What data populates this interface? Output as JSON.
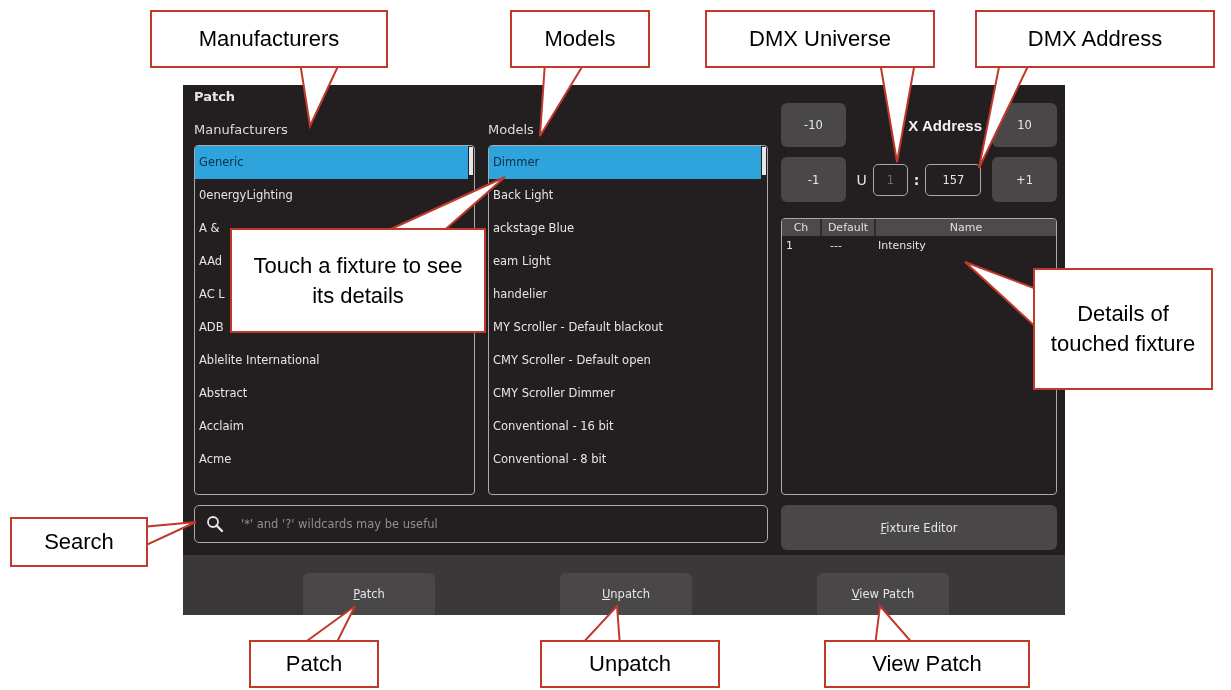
{
  "window": {
    "title": "Patch"
  },
  "manufacturers": {
    "label": "Manufacturers",
    "items": [
      {
        "name": "Generic",
        "selected": true
      },
      {
        "name": "0energyLighting",
        "selected": false
      },
      {
        "name": "A &",
        "selected": false
      },
      {
        "name": "AAd",
        "selected": false
      },
      {
        "name": "AC L",
        "selected": false
      },
      {
        "name": "ADB",
        "selected": false
      },
      {
        "name": "Ablelite International",
        "selected": false
      },
      {
        "name": "Abstract",
        "selected": false
      },
      {
        "name": "Acclaim",
        "selected": false
      },
      {
        "name": "Acme",
        "selected": false
      }
    ]
  },
  "models": {
    "label": "Models",
    "items": [
      {
        "name": "Dimmer",
        "selected": true
      },
      {
        "name": "Back Light",
        "selected": false
      },
      {
        "name": "ackstage Blue",
        "selected": false
      },
      {
        "name": "eam Light",
        "selected": false
      },
      {
        "name": "handelier",
        "selected": false
      },
      {
        "name": "MY Scroller - Default blackout",
        "selected": false
      },
      {
        "name": "CMY Scroller - Default open",
        "selected": false
      },
      {
        "name": "CMY Scroller Dimmer",
        "selected": false
      },
      {
        "name": "Conventional - 16 bit",
        "selected": false
      },
      {
        "name": "Conventional - 8 bit",
        "selected": false
      }
    ]
  },
  "dmx": {
    "title": "X Address",
    "buttons": [
      "-10",
      "10",
      "-1",
      "+1"
    ],
    "universe_label": "U",
    "universe": {
      "value": "1",
      "disabled": true
    },
    "separator": ":",
    "address": "157"
  },
  "details": {
    "columns": [
      "Ch",
      "Default",
      "Name"
    ],
    "rows": [
      [
        "1",
        "---",
        "Intensity"
      ]
    ]
  },
  "search": {
    "placeholder": "'*' and '?' wildcards may be useful"
  },
  "fixture_editor": {
    "label": "Fixture Editor",
    "mnemonic": true
  },
  "actions": [
    {
      "label": "Patch",
      "mnemonic": true
    },
    {
      "label": "Unpatch",
      "mnemonic": true
    },
    {
      "label": "View Patch",
      "mnemonic": true
    }
  ],
  "callouts": [
    "Manufacturers",
    "Models",
    "DMX Universe",
    "DMX Address",
    "Touch a fixture to see its details",
    "Details of touched fixture",
    "Search",
    "Patch",
    "Unpatch",
    "View Patch"
  ]
}
